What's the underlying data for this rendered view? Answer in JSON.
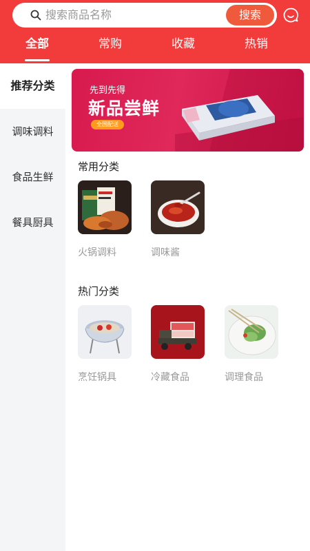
{
  "search": {
    "placeholder": "搜索商品名称",
    "button_label": "搜索"
  },
  "tabs": [
    {
      "label": "全部",
      "active": true
    },
    {
      "label": "常购",
      "active": false
    },
    {
      "label": "收藏",
      "active": false
    },
    {
      "label": "热销",
      "active": false
    }
  ],
  "sidebar": {
    "items": [
      {
        "label": "推荐分类",
        "active": true
      },
      {
        "label": "调味调料",
        "active": false
      },
      {
        "label": "食品生鲜",
        "active": false
      },
      {
        "label": "餐具厨具",
        "active": false
      }
    ]
  },
  "banner": {
    "subtitle": "先到先得",
    "title": "新品尝鲜",
    "pill": "全国配送"
  },
  "sections": [
    {
      "title": "常用分类",
      "items": [
        {
          "label": "火锅调料",
          "icon": "hotpot-seasoning-image"
        },
        {
          "label": "调味酱",
          "icon": "seasoning-sauce-image"
        }
      ]
    },
    {
      "title": "热门分类",
      "items": [
        {
          "label": "烹饪锅具",
          "icon": "cooking-pot-image"
        },
        {
          "label": "冷藏食品",
          "icon": "refrigerated-food-image"
        },
        {
          "label": "调理食品",
          "icon": "prepared-food-image"
        }
      ]
    }
  ],
  "colors": {
    "brand_red": "#f23c3c",
    "search_button": "#f05a3c",
    "sidebar_bg": "#f4f5f7",
    "muted_text": "#999999"
  }
}
